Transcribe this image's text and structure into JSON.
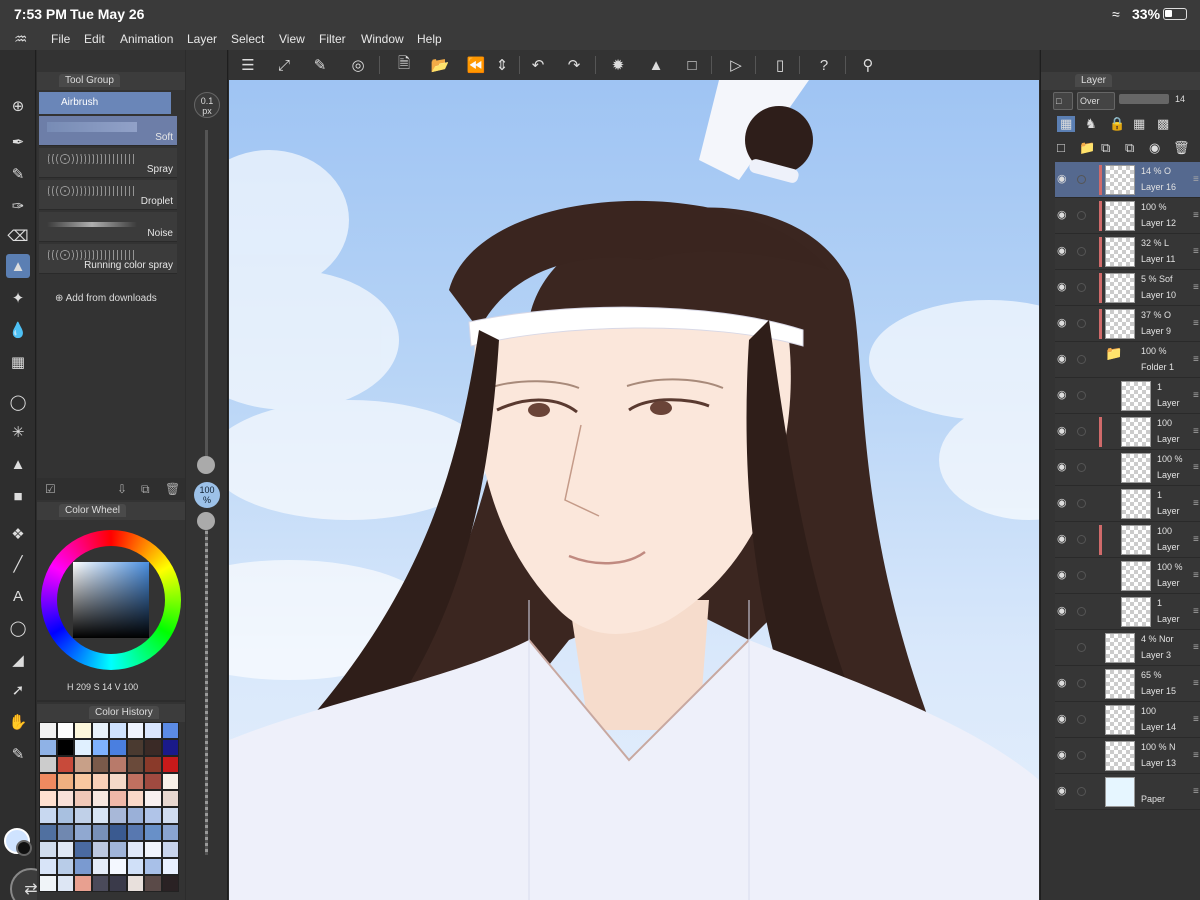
{
  "status": {
    "time": "7:53 PM",
    "date": "Tue May 26",
    "battery": "33%"
  },
  "menu": [
    "File",
    "Edit",
    "Animation",
    "Layer",
    "Select",
    "View",
    "Filter",
    "Window",
    "Help"
  ],
  "tool_panel": {
    "tab_label": "Tool Group",
    "sub_tool": "Airbrush",
    "brushes": [
      {
        "label": "Soft",
        "active": true
      },
      {
        "label": "Spray",
        "active": false
      },
      {
        "label": "Droplet",
        "active": false
      },
      {
        "label": "Noise",
        "active": false
      },
      {
        "label": "Running color spray",
        "active": false
      }
    ],
    "add_downloads": "Add from downloads"
  },
  "brush_size": {
    "size": "0.1",
    "size_unit": "px",
    "opacity": "100",
    "opacity_unit": "%"
  },
  "color_panel": {
    "tab_label": "Color Wheel",
    "h": "209",
    "s": "14",
    "v": "100",
    "h_label": "H",
    "s_label": "S",
    "v_label": "V"
  },
  "history_panel": {
    "tab_label": "Color History",
    "swatches": [
      "#f2f2f2",
      "#ffffff",
      "#fdf7dc",
      "#e8f2fb",
      "#cfe3ff",
      "#eef4ff",
      "#d8e6ff",
      "#5b8be5",
      "#8fb2e6",
      "#000000",
      "#e0f0ff",
      "#7fb2ff",
      "#4a7fe0",
      "#4a3a30",
      "#3a2a26",
      "#1a1a8a",
      "#cccccc",
      "#c84a3a",
      "#c8a088",
      "#7a5a4a",
      "#b87a6a",
      "#6a4a3a",
      "#8a3a2a",
      "#c81a1a",
      "#f08a60",
      "#f0b080",
      "#f8c8a0",
      "#f8d0b8",
      "#f4d8c8",
      "#c07060",
      "#a04a40",
      "#f8f0e8",
      "#ffe0d0",
      "#f8e0d8",
      "#f0c8b8",
      "#f8e8e0",
      "#f0b8a8",
      "#fad8c8",
      "#f8f0f0",
      "#e8d8d0",
      "#c8d8f0",
      "#a8c0e0",
      "#c0d0e8",
      "#d8e4f4",
      "#a8b8d8",
      "#9ab0d8",
      "#b0c4e8",
      "#d0dcf0",
      "#5070a0",
      "#7088b0",
      "#90a8d0",
      "#7890b8",
      "#3a5a90",
      "#5878b0",
      "#6890c8",
      "#8aa4d0",
      "#d0dcec",
      "#e0e8f4",
      "#4a6aa0",
      "#bcc8e0",
      "#a0b4d8",
      "#e0e8f8",
      "#f0f4fc",
      "#c8d4ec",
      "#d8e4f8",
      "#b8cce8",
      "#7a9ad0",
      "#e4ecf8",
      "#f4f8ff",
      "#d0e0f8",
      "#a8c0e8",
      "#e8f0ff",
      "#f0f4f8",
      "#dde6f4",
      "#e8a090",
      "#4a4a5a",
      "#3a3a4a",
      "#e8e0dc",
      "#5a4a48",
      "#2a2224"
    ]
  },
  "layer_panel": {
    "tab_label": "Layer",
    "blend_mode": "Over",
    "opacity": "14",
    "layers": [
      {
        "opacity": "14 %",
        "mode": "O",
        "name": "Layer 16",
        "selected": true,
        "visible": true,
        "flag": true,
        "indent": false
      },
      {
        "opacity": "100 %",
        "mode": "",
        "name": "Layer 12",
        "selected": false,
        "visible": true,
        "flag": true,
        "indent": false
      },
      {
        "opacity": "32 %",
        "mode": "L",
        "name": "Layer 11",
        "selected": false,
        "visible": true,
        "flag": true,
        "indent": false
      },
      {
        "opacity": "5 %",
        "mode": "Sof",
        "name": "Layer 10",
        "selected": false,
        "visible": true,
        "flag": true,
        "indent": false
      },
      {
        "opacity": "37 %",
        "mode": "O",
        "name": "Layer 9",
        "selected": false,
        "visible": true,
        "flag": true,
        "indent": false
      },
      {
        "opacity": "100 %",
        "mode": "",
        "name": "Folder 1",
        "selected": false,
        "visible": true,
        "flag": false,
        "indent": false,
        "folder": true
      },
      {
        "opacity": "1",
        "mode": "",
        "name": "Layer",
        "selected": false,
        "visible": true,
        "flag": false,
        "indent": true
      },
      {
        "opacity": "100",
        "mode": "",
        "name": "Layer",
        "selected": false,
        "visible": true,
        "flag": true,
        "indent": true
      },
      {
        "opacity": "100 %",
        "mode": "",
        "name": "Layer",
        "selected": false,
        "visible": true,
        "flag": false,
        "indent": true
      },
      {
        "opacity": "1",
        "mode": "",
        "name": "Layer",
        "selected": false,
        "visible": true,
        "flag": false,
        "indent": true
      },
      {
        "opacity": "100",
        "mode": "",
        "name": "Layer",
        "selected": false,
        "visible": true,
        "flag": true,
        "indent": true
      },
      {
        "opacity": "100 %",
        "mode": "",
        "name": "Layer",
        "selected": false,
        "visible": true,
        "flag": false,
        "indent": true
      },
      {
        "opacity": "1",
        "mode": "",
        "name": "Layer",
        "selected": false,
        "visible": true,
        "flag": false,
        "indent": true
      },
      {
        "opacity": "4 %",
        "mode": "Nor",
        "name": "Layer 3",
        "selected": false,
        "visible": false,
        "flag": false,
        "indent": false
      },
      {
        "opacity": "65 %",
        "mode": "",
        "name": "Layer 15",
        "selected": false,
        "visible": true,
        "flag": false,
        "indent": false
      },
      {
        "opacity": "100",
        "mode": "",
        "name": "Layer 14",
        "selected": false,
        "visible": true,
        "flag": false,
        "indent": false
      },
      {
        "opacity": "100 %",
        "mode": "N",
        "name": "Layer 13",
        "selected": false,
        "visible": true,
        "flag": false,
        "indent": false
      },
      {
        "opacity": "",
        "mode": "",
        "name": "Paper",
        "selected": false,
        "visible": true,
        "flag": false,
        "indent": false,
        "paper": true
      }
    ]
  },
  "colors": {
    "accent": "#5b7fb3",
    "panel": "#333333",
    "selected_layer": "#55698f"
  }
}
